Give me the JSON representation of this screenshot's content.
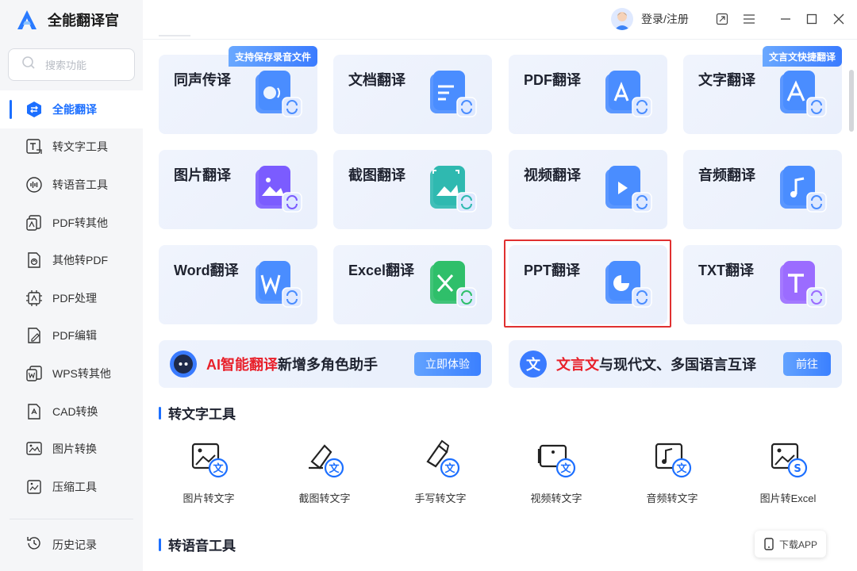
{
  "app": {
    "name": "全能翻译官"
  },
  "search": {
    "placeholder": "搜索功能"
  },
  "sidebar": {
    "items": [
      {
        "label": "全能翻译",
        "icon": "translate-icon",
        "active": true
      },
      {
        "label": "转文字工具",
        "icon": "text-tool-icon"
      },
      {
        "label": "转语音工具",
        "icon": "voice-tool-icon"
      },
      {
        "label": "PDF转其他",
        "icon": "pdf-convert-icon"
      },
      {
        "label": "其他转PDF",
        "icon": "to-pdf-icon"
      },
      {
        "label": "PDF处理",
        "icon": "pdf-process-icon"
      },
      {
        "label": "PDF编辑",
        "icon": "pdf-edit-icon"
      },
      {
        "label": "WPS转其他",
        "icon": "wps-convert-icon"
      },
      {
        "label": "CAD转换",
        "icon": "cad-convert-icon"
      },
      {
        "label": "图片转换",
        "icon": "image-convert-icon"
      },
      {
        "label": "压缩工具",
        "icon": "compress-icon"
      }
    ],
    "history": "历史记录"
  },
  "header": {
    "login": "登录/注册"
  },
  "cards": [
    {
      "title": "同声传译",
      "badge": "支持保存录音文件",
      "icon": "interpret-icon",
      "color": "#4a8dff"
    },
    {
      "title": "文档翻译",
      "icon": "document-icon",
      "color": "#4a8dff"
    },
    {
      "title": "PDF翻译",
      "icon": "pdf-icon",
      "color": "#4a8dff"
    },
    {
      "title": "文字翻译",
      "badge": "文言文快捷翻译",
      "icon": "text-translate-icon",
      "color": "#4a8dff"
    },
    {
      "title": "图片翻译",
      "icon": "image-icon",
      "color": "#7b5cff"
    },
    {
      "title": "截图翻译",
      "icon": "screenshot-icon",
      "color": "#2fb9b0"
    },
    {
      "title": "视频翻译",
      "icon": "video-icon",
      "color": "#4a8dff"
    },
    {
      "title": "音频翻译",
      "icon": "audio-icon",
      "color": "#4a8dff"
    },
    {
      "title": "Word翻译",
      "icon": "word-icon",
      "color": "#4a8dff"
    },
    {
      "title": "Excel翻译",
      "icon": "excel-icon",
      "color": "#2fbf6a"
    },
    {
      "title": "PPT翻译",
      "icon": "ppt-icon",
      "color": "#4a8dff"
    },
    {
      "title": "TXT翻译",
      "icon": "txt-icon",
      "color": "#9b6cff"
    }
  ],
  "banners": [
    {
      "highlight": "AI智能翻译",
      "text": "新增多角色助手",
      "button": "立即体验",
      "icon": "robot-icon"
    },
    {
      "highlight": "文言文",
      "text": "与现代文、多国语言互译",
      "button": "前往",
      "icon": "wen-icon",
      "icon_char": "文"
    }
  ],
  "sections": [
    {
      "title": "转文字工具"
    },
    {
      "title": "转语音工具"
    }
  ],
  "tools": [
    {
      "label": "图片转文字",
      "icon": "image-to-text-icon"
    },
    {
      "label": "截图转文字",
      "icon": "screenshot-to-text-icon"
    },
    {
      "label": "手写转文字",
      "icon": "handwriting-to-text-icon"
    },
    {
      "label": "视频转文字",
      "icon": "video-to-text-icon"
    },
    {
      "label": "音频转文字",
      "icon": "audio-to-text-icon"
    },
    {
      "label": "图片转Excel",
      "icon": "image-to-excel-icon"
    }
  ],
  "download": {
    "label": "下载APP"
  },
  "colors": {
    "accent": "#1c6fff",
    "highlight_red": "#e8202a",
    "selection_border": "#e03030"
  }
}
